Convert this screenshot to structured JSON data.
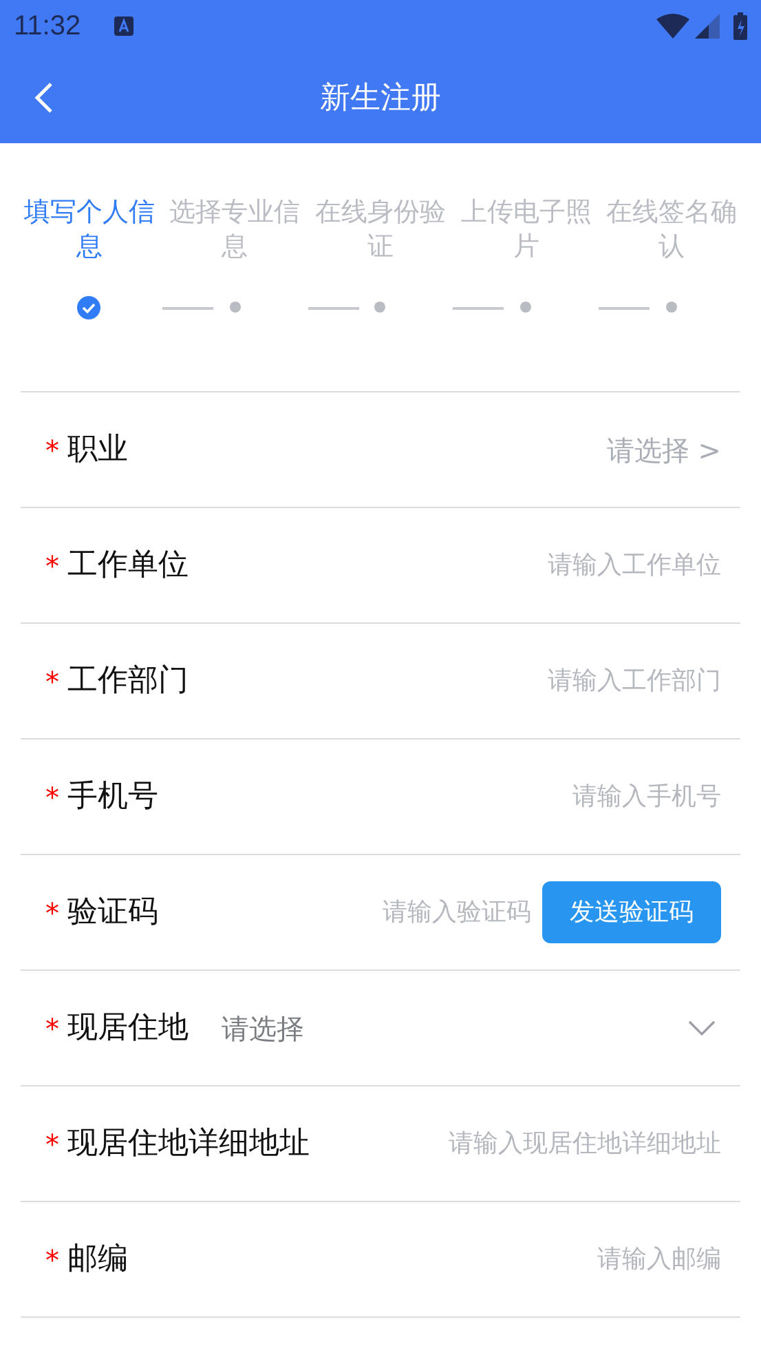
{
  "status_bar": {
    "time": "11:32"
  },
  "header": {
    "title": "新生注册"
  },
  "steps": [
    {
      "label": "填写个人信息",
      "selected": true,
      "done": true
    },
    {
      "label": "选择专业信息",
      "selected": false,
      "done": false
    },
    {
      "label": "在线身份验证",
      "selected": false,
      "done": false
    },
    {
      "label": "上传电子照片",
      "selected": false,
      "done": false
    },
    {
      "label": "在线签名确认",
      "selected": false,
      "done": false
    }
  ],
  "fields": [
    {
      "kind": "select",
      "mark": "*",
      "label": "职业",
      "placeholder": "请选择 >"
    },
    {
      "kind": "input",
      "mark": "*",
      "label": "工作单位",
      "placeholder": "请输入工作单位"
    },
    {
      "kind": "input",
      "mark": "*",
      "label": "工作部门",
      "placeholder": "请输入工作部门"
    },
    {
      "kind": "input",
      "mark": "*",
      "label": "手机号",
      "placeholder": "请输入手机号"
    },
    {
      "kind": "code",
      "mark": "*",
      "label": "验证码",
      "placeholder": "请输入验证码",
      "button": "发送验证码"
    },
    {
      "kind": "dropdown",
      "mark": "*",
      "label": "现居住地",
      "placeholder": "请选择"
    },
    {
      "kind": "input",
      "mark": "*",
      "label": "现居住地详细地址",
      "placeholder": "请输入现居住地详细地址"
    },
    {
      "kind": "input",
      "mark": "*",
      "label": "邮编",
      "placeholder": "请输入邮编"
    }
  ]
}
